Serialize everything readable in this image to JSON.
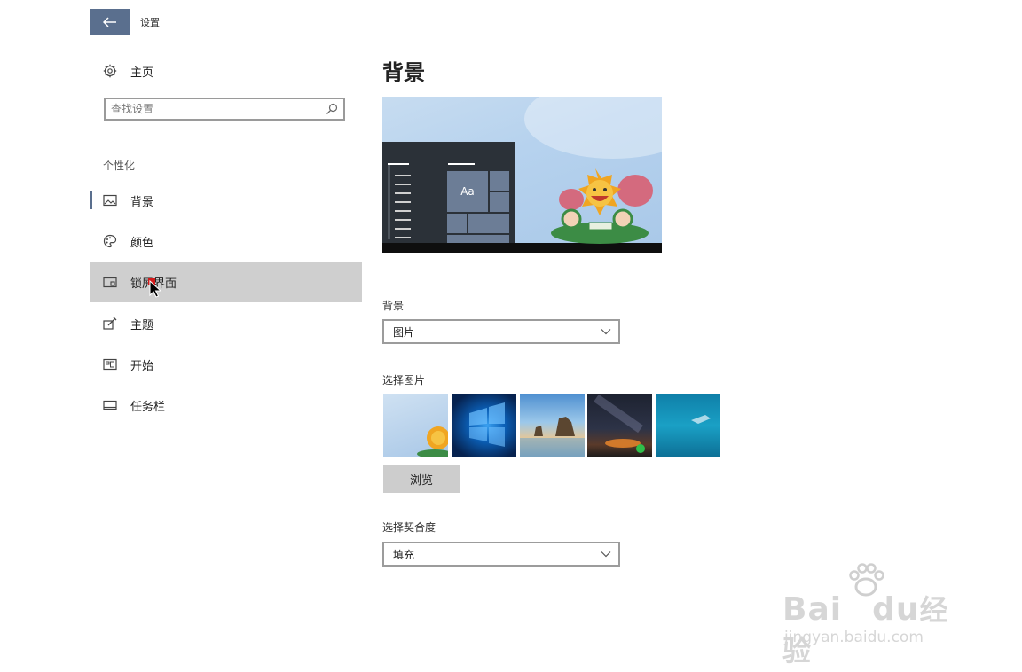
{
  "window": {
    "title": "设置",
    "back_label": "←"
  },
  "sidebar": {
    "home_label": "主页",
    "search_placeholder": "查找设置",
    "section_title": "个性化",
    "items": [
      {
        "label": "背景",
        "icon": "picture-icon",
        "state": "selected"
      },
      {
        "label": "颜色",
        "icon": "palette-icon"
      },
      {
        "label": "锁屏界面",
        "icon": "lock-screen-icon",
        "state": "hovered"
      },
      {
        "label": "主题",
        "icon": "theme-icon"
      },
      {
        "label": "开始",
        "icon": "start-icon"
      },
      {
        "label": "任务栏",
        "icon": "taskbar-icon"
      }
    ]
  },
  "main": {
    "heading": "背景",
    "preview": {
      "tile_text": "Aa"
    },
    "background_label": "背景",
    "background_value": "图片",
    "choose_picture_label": "选择图片",
    "browse_label": "浏览",
    "fit_label": "选择契合度",
    "fit_value": "填充"
  },
  "watermark": {
    "brand": "Bai",
    "brand2": "du",
    "suffix": "经验",
    "url": "jingyan.baidu.com"
  },
  "colors": {
    "accent": "#5a6f8e",
    "hover": "#cfcfcf"
  }
}
